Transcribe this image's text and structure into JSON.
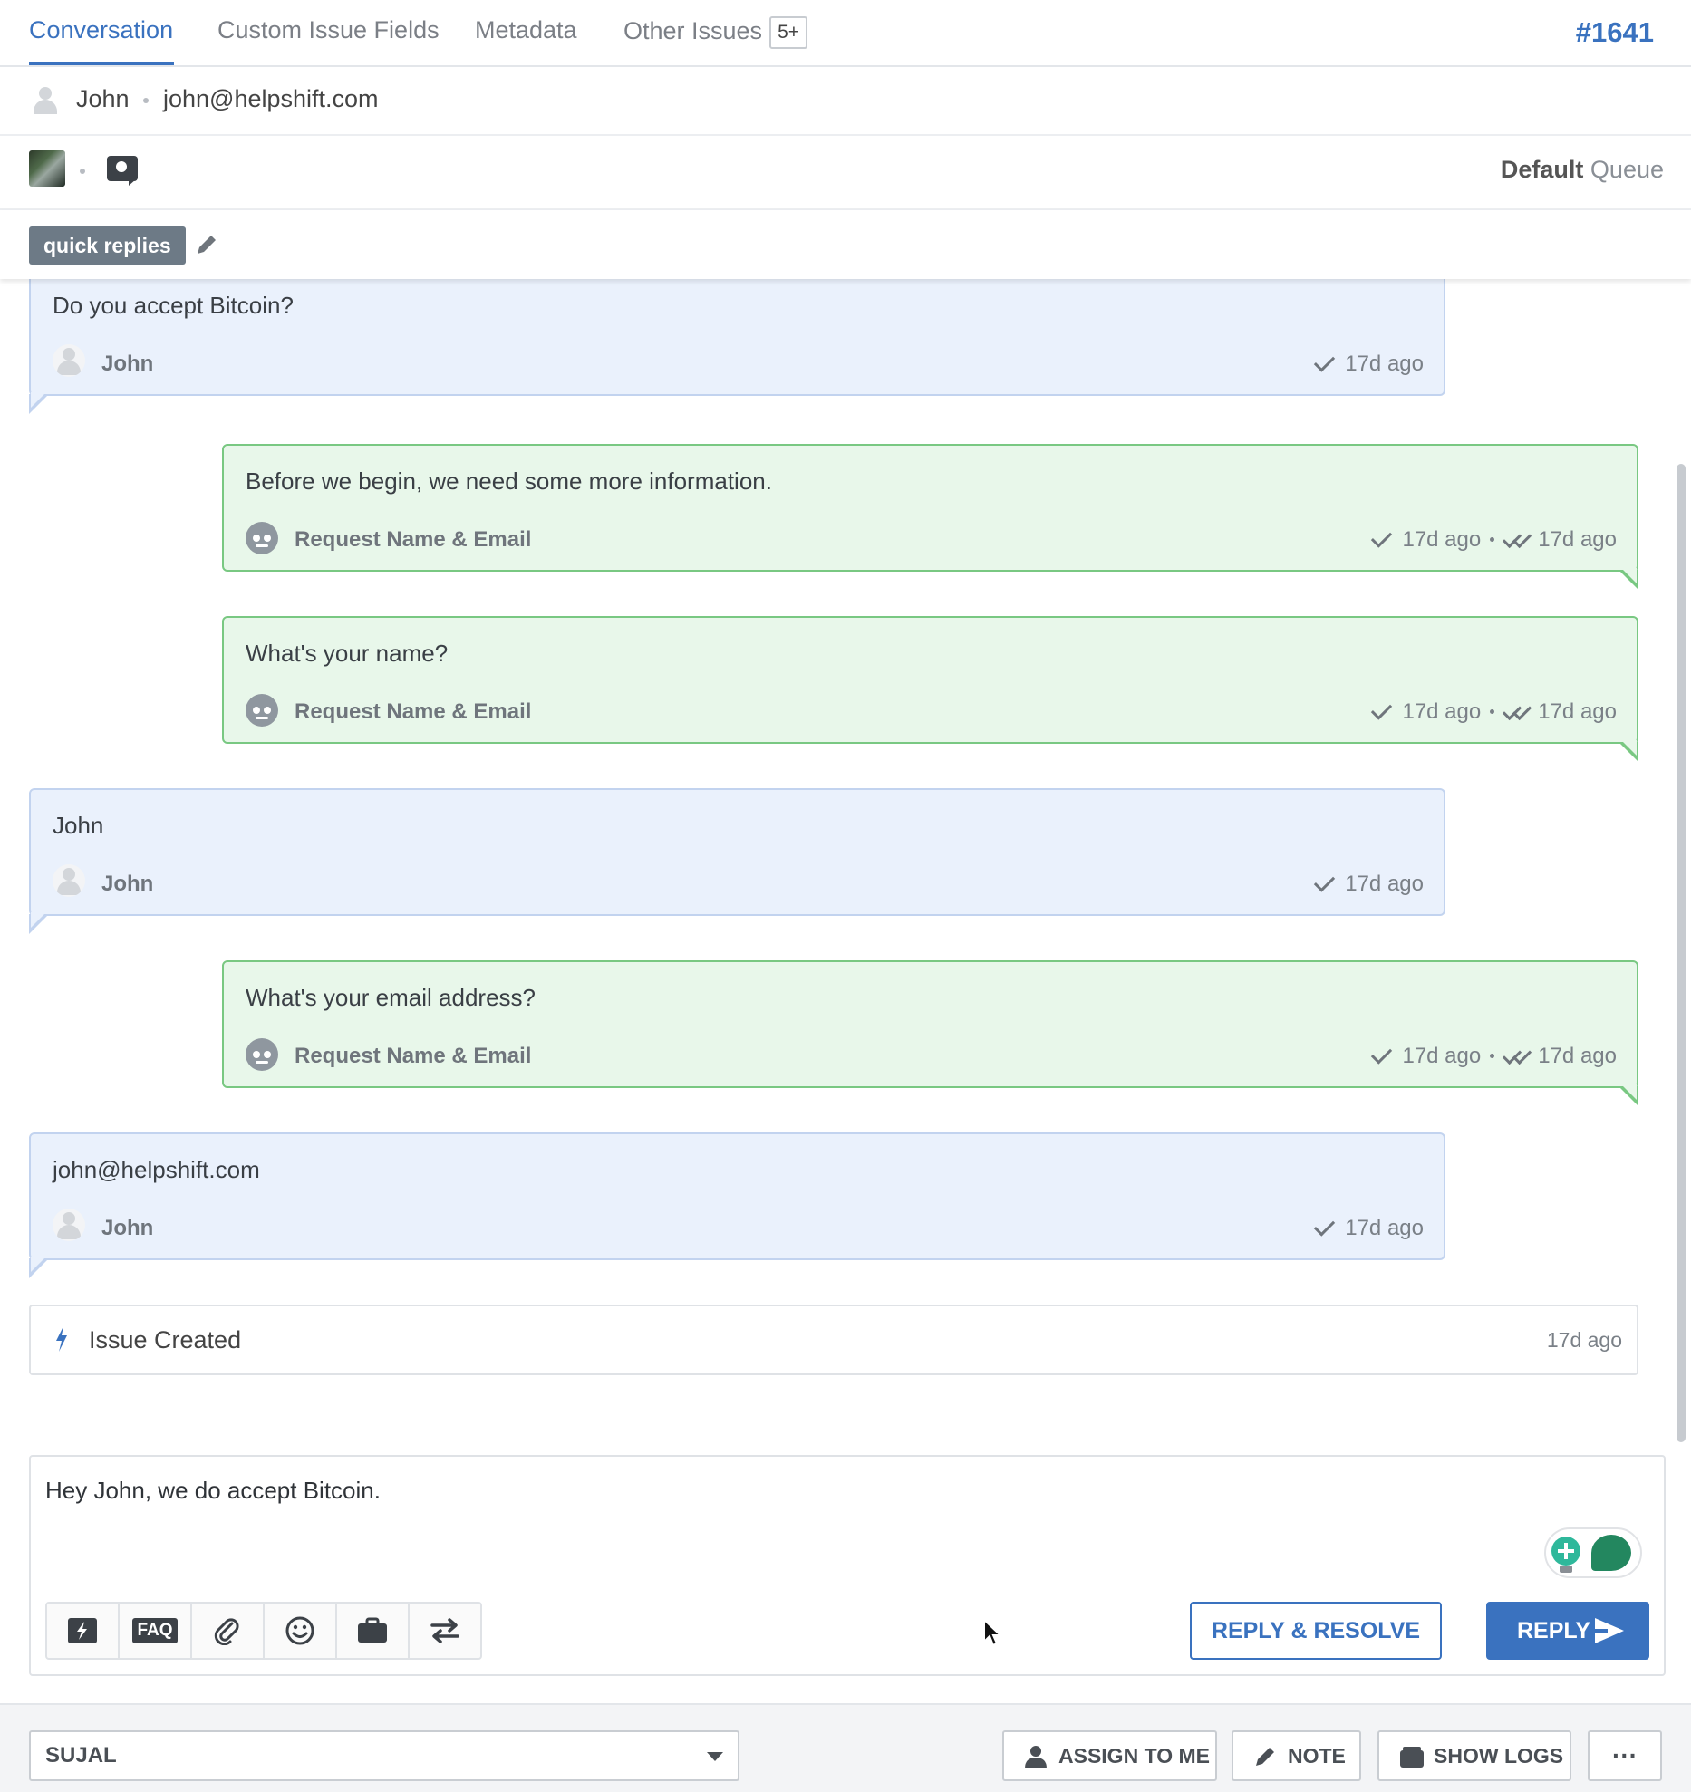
{
  "tabs": [
    {
      "label": "Conversation",
      "active": true
    },
    {
      "label": "Custom Issue Fields"
    },
    {
      "label": "Metadata"
    },
    {
      "label": "Other Issues",
      "badge": "5+"
    }
  ],
  "issue_id": "#1641",
  "user": {
    "name": "John",
    "email": "john@helpshift.com"
  },
  "queue": {
    "name": "Default",
    "label": "Queue"
  },
  "tag": {
    "label": "quick replies"
  },
  "messages": [
    {
      "type": "user",
      "text": "Do you accept Bitcoin?",
      "author": "John",
      "time": "17d ago"
    },
    {
      "type": "bot",
      "text": "Before we begin, we need some more information.",
      "author": "Request Name & Email",
      "sent": "17d ago",
      "read": "17d ago"
    },
    {
      "type": "bot",
      "text": "What's your name?",
      "author": "Request Name & Email",
      "sent": "17d ago",
      "read": "17d ago"
    },
    {
      "type": "user",
      "text": "John",
      "author": "John",
      "time": "17d ago"
    },
    {
      "type": "bot",
      "text": "What's your email address?",
      "author": "Request Name & Email",
      "sent": "17d ago",
      "read": "17d ago"
    },
    {
      "type": "user",
      "text": "john@helpshift.com",
      "author": "John",
      "time": "17d ago"
    }
  ],
  "event": {
    "label": "Issue Created",
    "time": "17d ago"
  },
  "composer": {
    "value": "Hey John, we do accept Bitcoin.",
    "toolbar": [
      "quick-reply-icon",
      "FAQ",
      "attachment-icon",
      "emoji-icon",
      "briefcase-icon",
      "transfer-icon"
    ],
    "reply_resolve_label": "REPLY & RESOLVE",
    "reply_label": "REPLY"
  },
  "footer": {
    "assignee": "SUJAL",
    "assign_label": "ASSIGN TO ME",
    "note_label": "NOTE",
    "logs_label": "SHOW LOGS",
    "more_label": "···"
  },
  "colors": {
    "accent": "#3a72bf",
    "user_bubble": "#eaf1fc",
    "bot_bubble": "#e8f7ea",
    "bot_border": "#79c882"
  }
}
